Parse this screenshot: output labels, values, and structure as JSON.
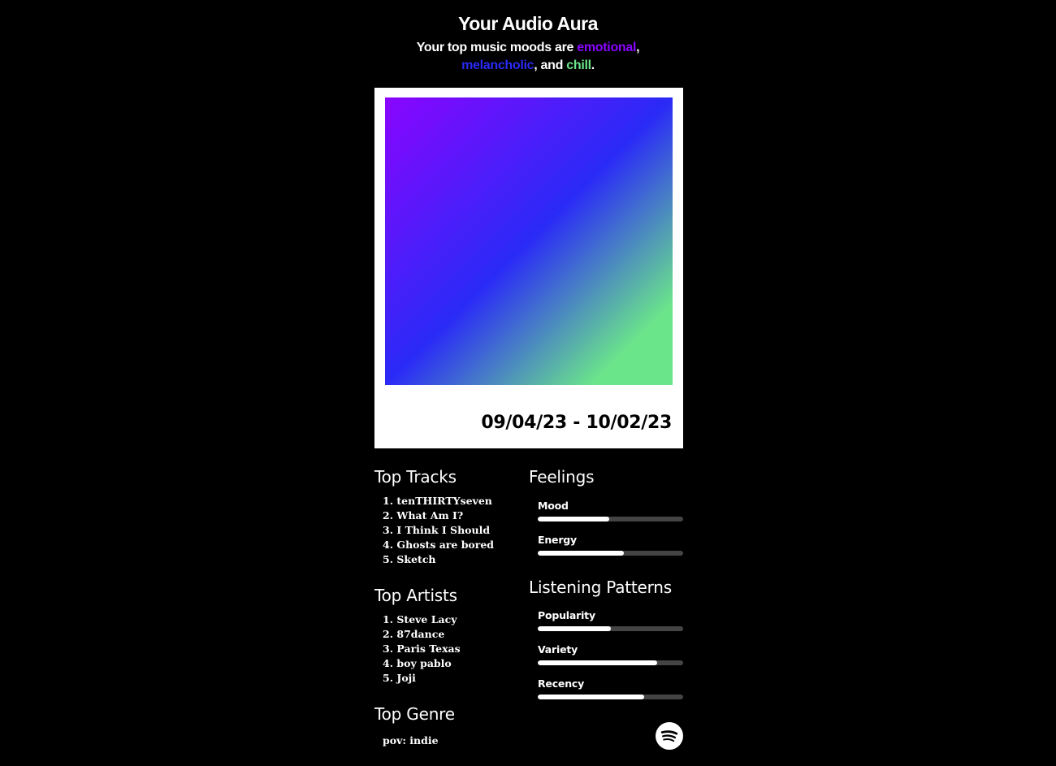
{
  "header": {
    "title": "Your Audio Aura",
    "subtitle_prefix": "Your top music moods are ",
    "moods": [
      {
        "label": "emotional",
        "color": "#8a05ff"
      },
      {
        "label": "melancholic",
        "color": "#2a2af7"
      },
      {
        "label": "chill",
        "color": "#6be58a"
      }
    ],
    "sep1": ", ",
    "sep2": ", and ",
    "end": "."
  },
  "card": {
    "date_range": "09/04/23 - 10/02/23",
    "gradient_colors": [
      "#8a05ff",
      "#2a2af7",
      "#6be58a"
    ]
  },
  "top_tracks": {
    "title": "Top Tracks",
    "items": [
      "1. tenTHIRTYseven",
      "2. What Am I?",
      "3. I Think I Should",
      "4. Ghosts are bored",
      "5. Sketch"
    ]
  },
  "top_artists": {
    "title": "Top Artists",
    "items": [
      "1. Steve Lacy",
      "2. 87dance",
      "3. Paris Texas",
      "4. boy pablo",
      "5. Joji"
    ]
  },
  "top_genre": {
    "title": "Top Genre",
    "value": "pov: indie"
  },
  "feelings": {
    "title": "Feelings",
    "metrics": [
      {
        "label": "Mood",
        "value": 0.49
      },
      {
        "label": "Energy",
        "value": 0.59
      }
    ]
  },
  "listening_patterns": {
    "title": "Listening Patterns",
    "metrics": [
      {
        "label": "Popularity",
        "value": 0.5
      },
      {
        "label": "Variety",
        "value": 0.82
      },
      {
        "label": "Recency",
        "value": 0.73
      }
    ]
  },
  "icons": {
    "spotify": "spotify-logo-icon"
  }
}
